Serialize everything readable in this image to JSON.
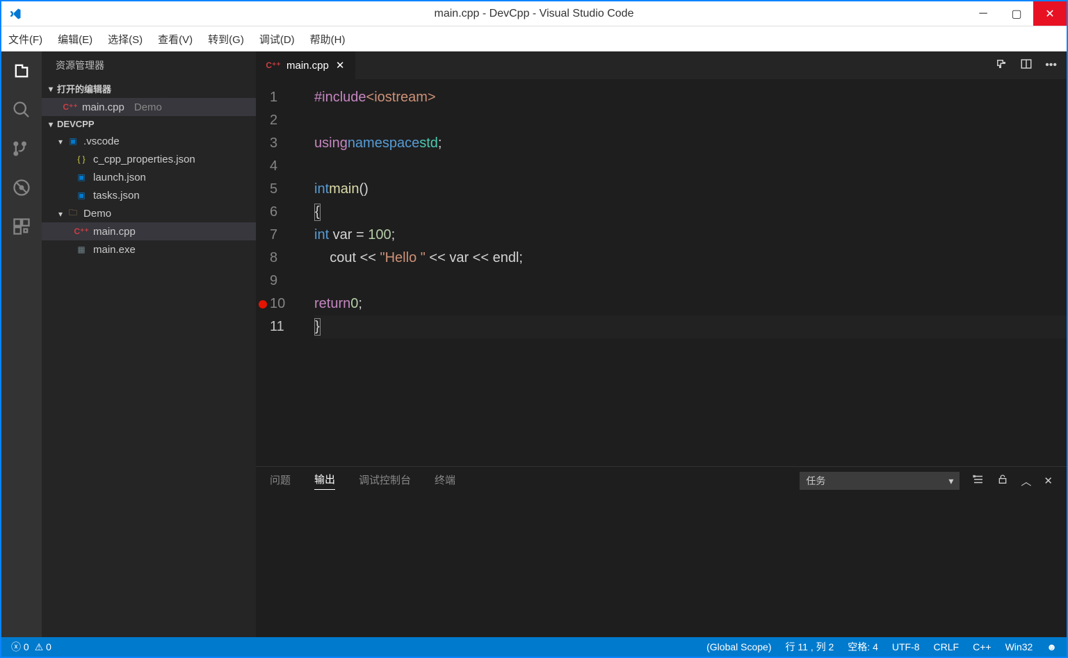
{
  "title": "main.cpp - DevCpp - Visual Studio Code",
  "menu": [
    "文件(F)",
    "编辑(E)",
    "选择(S)",
    "查看(V)",
    "转到(G)",
    "调试(D)",
    "帮助(H)"
  ],
  "sidebar": {
    "title": "资源管理器",
    "openEditors": "打开的编辑器",
    "openFile": {
      "name": "main.cpp",
      "folder": "Demo"
    },
    "project": "DEVCPP",
    "tree": {
      "vscode": ".vscode",
      "files_vscode": [
        "c_cpp_properties.json",
        "launch.json",
        "tasks.json"
      ],
      "demo": "Demo",
      "files_demo": [
        "main.cpp",
        "main.exe"
      ]
    }
  },
  "tab": {
    "name": "main.cpp"
  },
  "code": {
    "lines": [
      {
        "n": 1,
        "html": "<span class='k-macro'>#include</span> <span class='k-include-str'>&lt;iostream&gt;</span>"
      },
      {
        "n": 2,
        "html": ""
      },
      {
        "n": 3,
        "html": "<span class='k-other'>using</span> <span class='k-keyword'>namespace</span> <span class='k-type'>std</span>;"
      },
      {
        "n": 4,
        "html": ""
      },
      {
        "n": 5,
        "html": "<span class='k-keyword'>int</span> <span class='k-func'>main</span>()"
      },
      {
        "n": 6,
        "html": "<span class='bracket-box'>{</span>"
      },
      {
        "n": 7,
        "html": "    <span class='k-keyword'>int</span> var = <span class='k-num'>100</span>;"
      },
      {
        "n": 8,
        "html": "    cout &lt;&lt; <span class='k-str'>\"Hello \"</span> &lt;&lt; var &lt;&lt; endl;"
      },
      {
        "n": 9,
        "html": ""
      },
      {
        "n": 10,
        "html": "    <span class='k-other'>return</span> <span class='k-num'>0</span>;",
        "bp": true
      },
      {
        "n": 11,
        "html": "<span class='bracket-box'>}</span>",
        "active": true
      }
    ]
  },
  "panel": {
    "tabs": [
      "问题",
      "输出",
      "调试控制台",
      "终端"
    ],
    "active": 1,
    "select": "任务"
  },
  "status": {
    "errors": "0",
    "warnings": "0",
    "scope": "(Global Scope)",
    "line": "行 11 , 列 2",
    "spaces": "空格: 4",
    "encoding": "UTF-8",
    "eol": "CRLF",
    "lang": "C++",
    "config": "Win32"
  }
}
